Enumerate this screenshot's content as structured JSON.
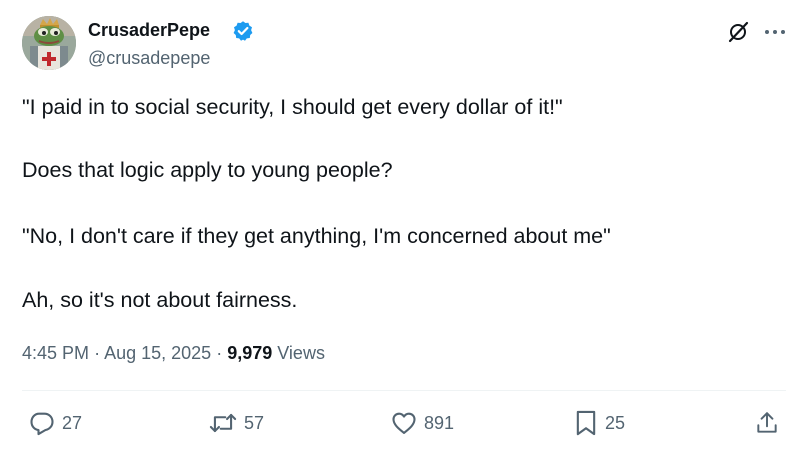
{
  "author": {
    "display_name": "CrusaderPepe",
    "handle": "@crusadepepe",
    "verified": true,
    "avatar_icon": "frog-crusader-avatar"
  },
  "header_actions": {
    "grok_icon": "grok-icon",
    "more_icon": "more-icon"
  },
  "tweet": {
    "lines": [
      "\"I paid in to social security, I should get every dollar of it!\"",
      "Does that logic apply to young people?",
      "\"No, I don't care if they get anything, I'm concerned about me\"",
      "Ah, so it's not about fairness."
    ],
    "time": "4:45 PM",
    "date": "Aug 15, 2025",
    "separator": "·",
    "views_count": "9,979",
    "views_label": "Views"
  },
  "actions": {
    "reply": {
      "icon": "reply-icon",
      "count": "27"
    },
    "repost": {
      "icon": "repost-icon",
      "count": "57"
    },
    "like": {
      "icon": "heart-icon",
      "count": "891"
    },
    "bookmark": {
      "icon": "bookmark-icon",
      "count": "25"
    },
    "share": {
      "icon": "share-icon"
    }
  },
  "colors": {
    "text": "#0f1419",
    "secondary": "#536471",
    "verified": "#1d9bf0",
    "divider": "#eff3f4"
  }
}
